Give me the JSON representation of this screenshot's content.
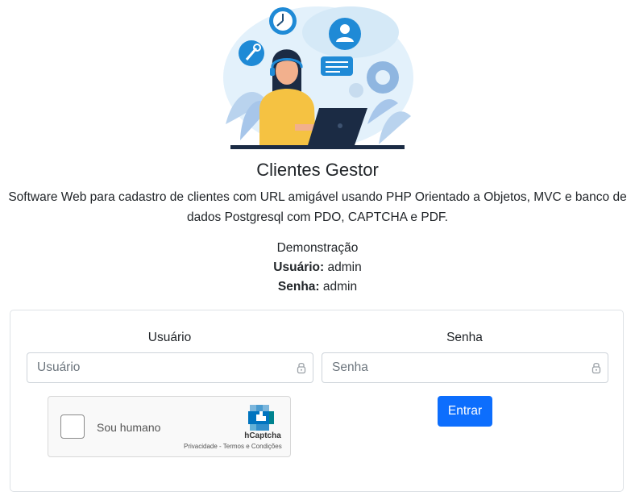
{
  "header": {
    "title": "Clientes Gestor",
    "description": "Software Web para cadastro de clientes com URL amigável usando PHP Orientado a Objetos, MVC e banco de dados Postgresql com PDO, CAPTCHA e PDF."
  },
  "demo": {
    "heading": "Demonstração",
    "user_label": "Usuário:",
    "user_value": "admin",
    "password_label": "Senha:",
    "password_value": "admin"
  },
  "form": {
    "user_label": "Usuário",
    "user_placeholder": "Usuário",
    "password_label": "Senha",
    "password_placeholder": "Senha",
    "submit_label": "Entrar",
    "accent_color": "#0d6efd"
  },
  "captcha": {
    "checkbox_label": "Sou humano",
    "brand": "hCaptcha",
    "links": "Privacidade - Termos e Condições"
  },
  "icons": {
    "hero": "customer-support-illustration",
    "input_lock": "lock-icon",
    "captcha_logo": "hcaptcha-logo-icon"
  }
}
